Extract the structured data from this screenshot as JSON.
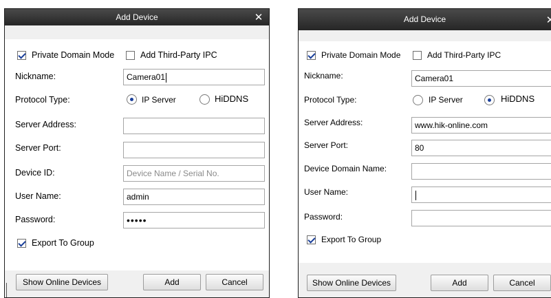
{
  "dialogs": [
    {
      "title": "Add Device",
      "close_glyph": "✕",
      "private_domain_mode": {
        "label": "Private Domain Mode",
        "checked": true
      },
      "add_third_party_ipc": {
        "label": "Add Third-Party IPC",
        "checked": false
      },
      "nickname": {
        "label": "Nickname:",
        "value": "Camera01"
      },
      "protocol_type": {
        "label": "Protocol Type:",
        "options": [
          "IP Server",
          "HiDDNS"
        ],
        "selected": "IP Server"
      },
      "server_address": {
        "label": "Server Address:",
        "value": ""
      },
      "server_port": {
        "label": "Server Port:",
        "value": ""
      },
      "device_id": {
        "label": "Device ID:",
        "placeholder": "Device Name / Serial No."
      },
      "user_name": {
        "label": "User Name:",
        "value": "admin"
      },
      "password": {
        "label": "Password:",
        "masked": "•••••"
      },
      "export_to_group": {
        "label": "Export To Group",
        "checked": true
      },
      "buttons": {
        "show_online_devices": "Show Online Devices",
        "add": "Add",
        "cancel": "Cancel"
      }
    },
    {
      "title": "Add Device",
      "close_glyph": "✕",
      "private_domain_mode": {
        "label": "Private Domain Mode",
        "checked": true
      },
      "add_third_party_ipc": {
        "label": "Add Third-Party IPC",
        "checked": false
      },
      "nickname": {
        "label": "Nickname:",
        "value": "Camera01"
      },
      "protocol_type": {
        "label": "Protocol Type:",
        "options": [
          "IP Server",
          "HiDDNS"
        ],
        "selected": "HiDDNS"
      },
      "server_address": {
        "label": "Server Address:",
        "value": "www.hik-online.com"
      },
      "server_port": {
        "label": "Server Port:",
        "value": "80"
      },
      "device_domain_name": {
        "label": "Device Domain Name:",
        "value": ""
      },
      "user_name": {
        "label": "User Name:",
        "value": ""
      },
      "password": {
        "label": "Password:",
        "value": ""
      },
      "export_to_group": {
        "label": "Export To Group",
        "checked": true
      },
      "buttons": {
        "show_online_devices": "Show Online Devices",
        "add": "Add",
        "cancel": "Cancel"
      }
    }
  ]
}
